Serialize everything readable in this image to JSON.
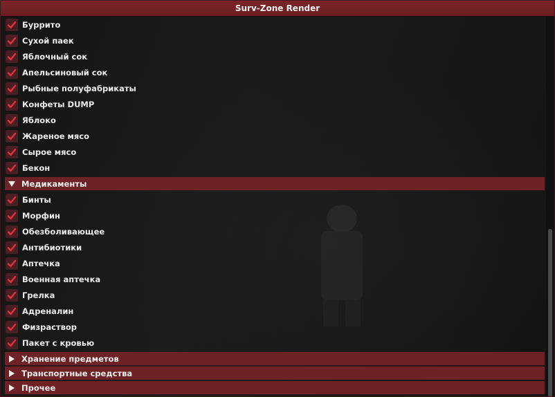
{
  "window": {
    "title": "Surv-Zone Render"
  },
  "food_items": [
    {
      "label": "Буррито",
      "checked": true
    },
    {
      "label": "Сухой паек",
      "checked": true
    },
    {
      "label": "Яблочный сок",
      "checked": true
    },
    {
      "label": "Апельсиновый сок",
      "checked": true
    },
    {
      "label": "Рыбные полуфабрикаты",
      "checked": true
    },
    {
      "label": "Конфеты DUMP",
      "checked": true
    },
    {
      "label": "Яблоко",
      "checked": true
    },
    {
      "label": "Жареное мясо",
      "checked": true
    },
    {
      "label": "Сырое мясо",
      "checked": true
    },
    {
      "label": "Бекон",
      "checked": true
    }
  ],
  "sections": {
    "medicine": {
      "label": "Медикаменты",
      "expanded": true
    },
    "storage": {
      "label": "Хранение предметов",
      "expanded": false
    },
    "transport": {
      "label": "Транспортные средства",
      "expanded": false
    },
    "other": {
      "label": "Прочее",
      "expanded": false
    }
  },
  "medicine_items": [
    {
      "label": "Бинты",
      "checked": true
    },
    {
      "label": "Морфин",
      "checked": true
    },
    {
      "label": "Обезболивающее",
      "checked": true
    },
    {
      "label": "Антибиотики",
      "checked": true
    },
    {
      "label": "Аптечка",
      "checked": true
    },
    {
      "label": "Военная аптечка",
      "checked": true
    },
    {
      "label": "Грелка",
      "checked": true
    },
    {
      "label": "Адреналин",
      "checked": true
    },
    {
      "label": "Физраствор",
      "checked": true
    },
    {
      "label": "Пакет с кровью",
      "checked": true
    }
  ],
  "colors": {
    "accent": "#6e2226",
    "check": "#e0343c",
    "title_bar": "#7a2428"
  }
}
